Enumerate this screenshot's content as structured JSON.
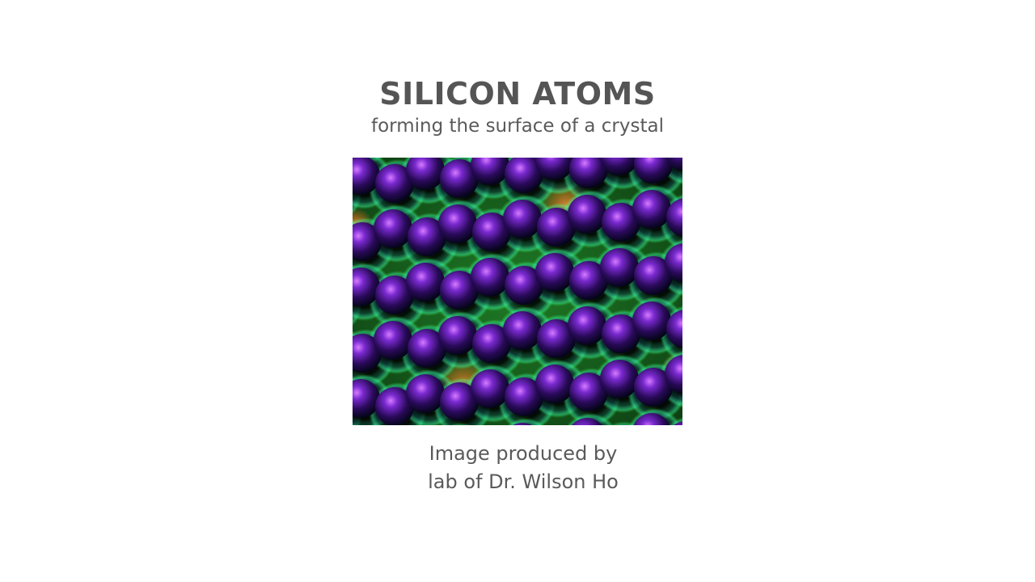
{
  "slide": {
    "title": "SILICON ATOMS",
    "subtitle": "forming the surface of a crystal",
    "caption_line1": "Image produced by",
    "caption_line2": "lab of Dr. Wilson Ho"
  },
  "colors": {
    "text": "#5a5a5a",
    "background": "#ffffff",
    "atom_core": "#3a0f6e",
    "atom_highlight": "#c45cff",
    "bond_glow": "#3cff3c",
    "hotspot": "#ff8c3a"
  }
}
